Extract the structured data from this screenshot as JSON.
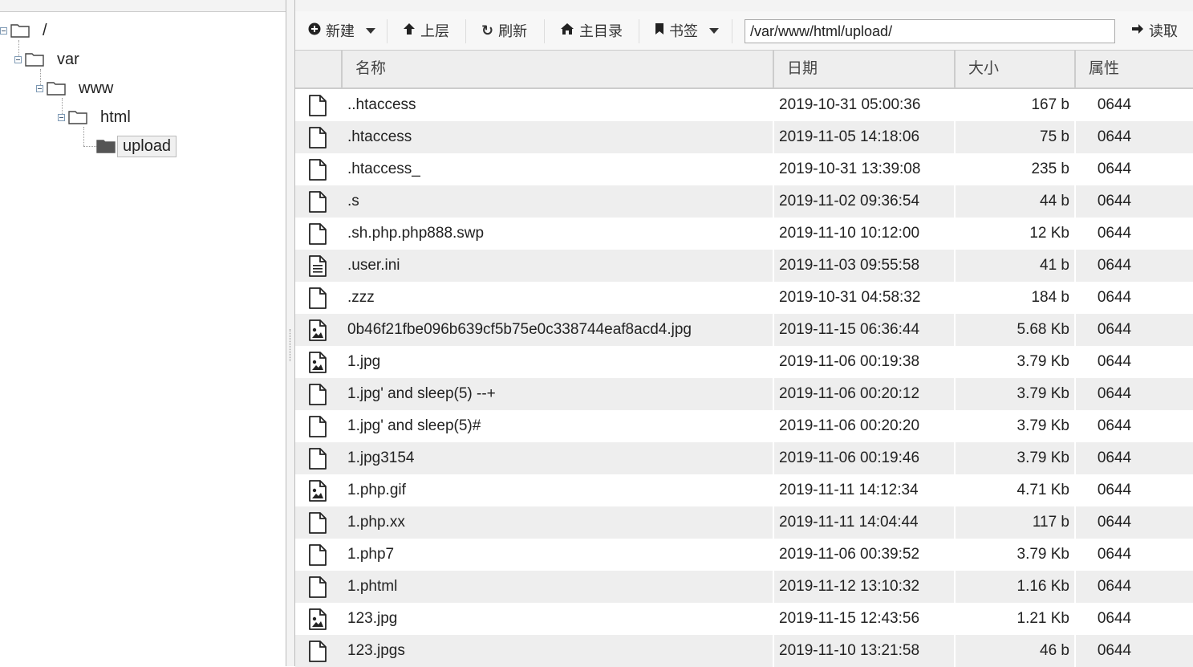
{
  "toolbar": {
    "new_label": "新建",
    "up_label": "上层",
    "refresh_label": "刷新",
    "home_label": "主目录",
    "bookmark_label": "书签",
    "path_value": "/var/www/html/upload/",
    "read_label": "读取"
  },
  "tree": {
    "root": "/",
    "var": "var",
    "www": "www",
    "html": "html",
    "upload": "upload"
  },
  "table": {
    "headers": {
      "name": "名称",
      "date": "日期",
      "size": "大小",
      "perm": "属性"
    },
    "rows": [
      {
        "icon": "file-icon",
        "name": "..htaccess",
        "date": "2019-10-31 05:00:36",
        "size": "167 b",
        "perm": "0644"
      },
      {
        "icon": "file-icon",
        "name": ".htaccess",
        "date": "2019-11-05 14:18:06",
        "size": "75 b",
        "perm": "0644"
      },
      {
        "icon": "file-icon",
        "name": ".htaccess_",
        "date": "2019-10-31 13:39:08",
        "size": "235 b",
        "perm": "0644"
      },
      {
        "icon": "file-icon",
        "name": ".s",
        "date": "2019-11-02 09:36:54",
        "size": "44 b",
        "perm": "0644"
      },
      {
        "icon": "file-icon",
        "name": ".sh.php.php888.swp",
        "date": "2019-11-10 10:12:00",
        "size": "12 Kb",
        "perm": "0644"
      },
      {
        "icon": "text-file-icon",
        "name": ".user.ini",
        "date": "2019-11-03 09:55:58",
        "size": "41 b",
        "perm": "0644"
      },
      {
        "icon": "file-icon",
        "name": ".zzz",
        "date": "2019-10-31 04:58:32",
        "size": "184 b",
        "perm": "0644"
      },
      {
        "icon": "image-file-icon",
        "name": "0b46f21fbe096b639cf5b75e0c338744eaf8acd4.jpg",
        "date": "2019-11-15 06:36:44",
        "size": "5.68 Kb",
        "perm": "0644"
      },
      {
        "icon": "image-file-icon",
        "name": "1.jpg",
        "date": "2019-11-06 00:19:38",
        "size": "3.79 Kb",
        "perm": "0644"
      },
      {
        "icon": "file-icon",
        "name": "1.jpg' and sleep(5) --+",
        "date": "2019-11-06 00:20:12",
        "size": "3.79 Kb",
        "perm": "0644"
      },
      {
        "icon": "file-icon",
        "name": "1.jpg' and sleep(5)#",
        "date": "2019-11-06 00:20:20",
        "size": "3.79 Kb",
        "perm": "0644"
      },
      {
        "icon": "file-icon",
        "name": "1.jpg3154",
        "date": "2019-11-06 00:19:46",
        "size": "3.79 Kb",
        "perm": "0644"
      },
      {
        "icon": "image-file-icon",
        "name": "1.php.gif",
        "date": "2019-11-11 14:12:34",
        "size": "4.71 Kb",
        "perm": "0644"
      },
      {
        "icon": "file-icon",
        "name": "1.php.xx",
        "date": "2019-11-11 14:04:44",
        "size": "117 b",
        "perm": "0644"
      },
      {
        "icon": "file-icon",
        "name": "1.php7",
        "date": "2019-11-06 00:39:52",
        "size": "3.79 Kb",
        "perm": "0644"
      },
      {
        "icon": "file-icon",
        "name": "1.phtml",
        "date": "2019-11-12 13:10:32",
        "size": "1.16 Kb",
        "perm": "0644"
      },
      {
        "icon": "image-file-icon",
        "name": "123.jpg",
        "date": "2019-11-15 12:43:56",
        "size": "1.21 Kb",
        "perm": "0644"
      },
      {
        "icon": "file-icon",
        "name": "123.jpgs",
        "date": "2019-11-10 13:21:58",
        "size": "46 b",
        "perm": "0644"
      }
    ]
  }
}
